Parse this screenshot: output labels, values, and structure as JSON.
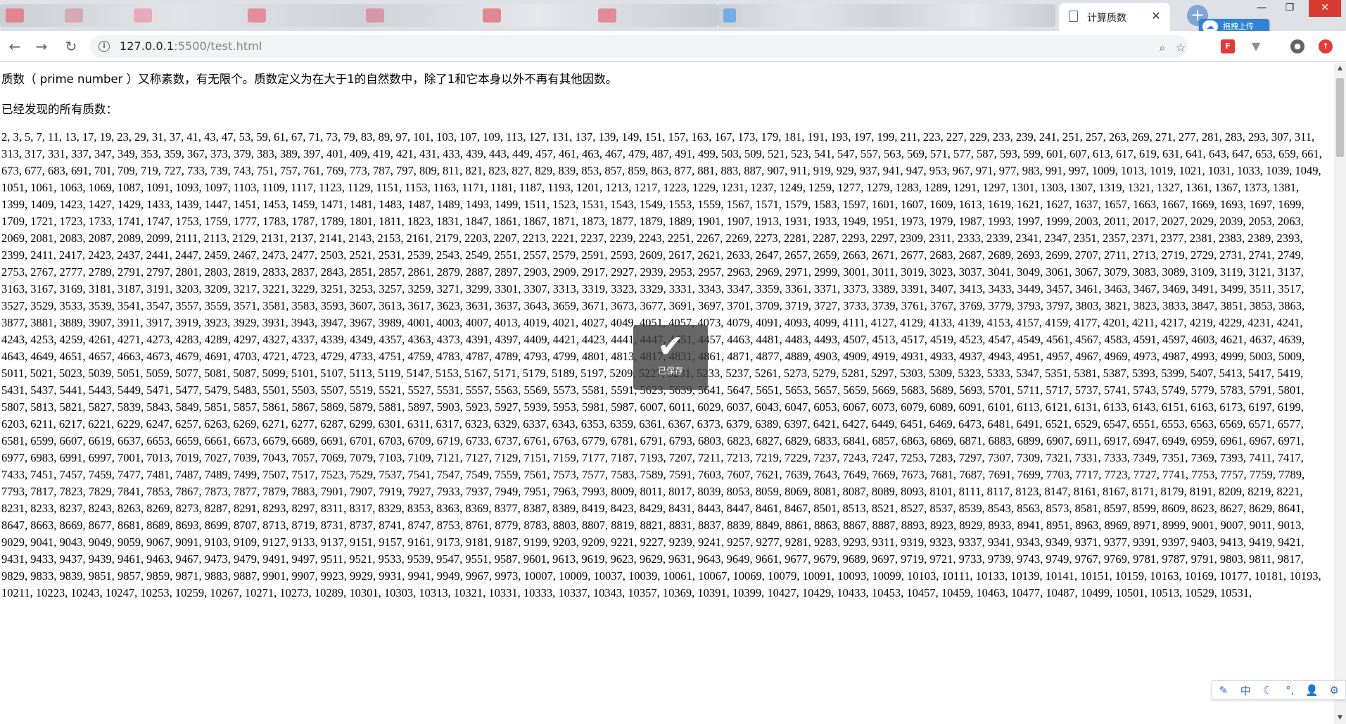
{
  "browser": {
    "active_tab_title": "计算质数",
    "close_tab_glyph": "✕",
    "new_tab_glyph": "+",
    "upload_badge_label": "拖拽上传",
    "url_host": "127.0.0.1",
    "url_rest": ":5500/test.html",
    "window_controls": [
      "—",
      "❐",
      "✕"
    ]
  },
  "page": {
    "intro": "质数（ prime number ）又称素数，有无限个。质数定义为在大于1的自然数中，除了1和它本身以外不再有其他因数。",
    "found_label": "已经发现的所有质数：",
    "primes_text": "2, 3, 5, 7, 11, 13, 17, 19, 23, 29, 31, 37, 41, 43, 47, 53, 59, 61, 67, 71, 73, 79, 83, 89, 97, 101, 103, 107, 109, 113, 127, 131, 137, 139, 149, 151, 157, 163, 167, 173, 179, 181, 191, 193, 197, 199, 211, 223, 227, 229, 233, 239, 241, 251, 257, 263, 269, 271, 277, 281, 283, 293, 307, 311, 313, 317, 331, 337, 347, 349, 353, 359, 367, 373, 379, 383, 389, 397, 401, 409, 419, 421, 431, 433, 439, 443, 449, 457, 461, 463, 467, 479, 487, 491, 499, 503, 509, 521, 523, 541, 547, 557, 563, 569, 571, 577, 587, 593, 599, 601, 607, 613, 617, 619, 631, 641, 643, 647, 653, 659, 661, 673, 677, 683, 691, 701, 709, 719, 727, 733, 739, 743, 751, 757, 761, 769, 773, 787, 797, 809, 811, 821, 823, 827, 829, 839, 853, 857, 859, 863, 877, 881, 883, 887, 907, 911, 919, 929, 937, 941, 947, 953, 967, 971, 977, 983, 991, 997, 1009, 1013, 1019, 1021, 1031, 1033, 1039, 1049, 1051, 1061, 1063, 1069, 1087, 1091, 1093, 1097, 1103, 1109, 1117, 1123, 1129, 1151, 1153, 1163, 1171, 1181, 1187, 1193, 1201, 1213, 1217, 1223, 1229, 1231, 1237, 1249, 1259, 1277, 1279, 1283, 1289, 1291, 1297, 1301, 1303, 1307, 1319, 1321, 1327, 1361, 1367, 1373, 1381, 1399, 1409, 1423, 1427, 1429, 1433, 1439, 1447, 1451, 1453, 1459, 1471, 1481, 1483, 1487, 1489, 1493, 1499, 1511, 1523, 1531, 1543, 1549, 1553, 1559, 1567, 1571, 1579, 1583, 1597, 1601, 1607, 1609, 1613, 1619, 1621, 1627, 1637, 1657, 1663, 1667, 1669, 1693, 1697, 1699, 1709, 1721, 1723, 1733, 1741, 1747, 1753, 1759, 1777, 1783, 1787, 1789, 1801, 1811, 1823, 1831, 1847, 1861, 1867, 1871, 1873, 1877, 1879, 1889, 1901, 1907, 1913, 1931, 1933, 1949, 1951, 1973, 1979, 1987, 1993, 1997, 1999, 2003, 2011, 2017, 2027, 2029, 2039, 2053, 2063, 2069, 2081, 2083, 2087, 2089, 2099, 2111, 2113, 2129, 2131, 2137, 2141, 2143, 2153, 2161, 2179, 2203, 2207, 2213, 2221, 2237, 2239, 2243, 2251, 2267, 2269, 2273, 2281, 2287, 2293, 2297, 2309, 2311, 2333, 2339, 2341, 2347, 2351, 2357, 2371, 2377, 2381, 2383, 2389, 2393, 2399, 2411, 2417, 2423, 2437, 2441, 2447, 2459, 2467, 2473, 2477, 2503, 2521, 2531, 2539, 2543, 2549, 2551, 2557, 2579, 2591, 2593, 2609, 2617, 2621, 2633, 2647, 2657, 2659, 2663, 2671, 2677, 2683, 2687, 2689, 2693, 2699, 2707, 2711, 2713, 2719, 2729, 2731, 2741, 2749, 2753, 2767, 2777, 2789, 2791, 2797, 2801, 2803, 2819, 2833, 2837, 2843, 2851, 2857, 2861, 2879, 2887, 2897, 2903, 2909, 2917, 2927, 2939, 2953, 2957, 2963, 2969, 2971, 2999, 3001, 3011, 3019, 3023, 3037, 3041, 3049, 3061, 3067, 3079, 3083, 3089, 3109, 3119, 3121, 3137, 3163, 3167, 3169, 3181, 3187, 3191, 3203, 3209, 3217, 3221, 3229, 3251, 3253, 3257, 3259, 3271, 3299, 3301, 3307, 3313, 3319, 3323, 3329, 3331, 3343, 3347, 3359, 3361, 3371, 3373, 3389, 3391, 3407, 3413, 3433, 3449, 3457, 3461, 3463, 3467, 3469, 3491, 3499, 3511, 3517, 3527, 3529, 3533, 3539, 3541, 3547, 3557, 3559, 3571, 3581, 3583, 3593, 3607, 3613, 3617, 3623, 3631, 3637, 3643, 3659, 3671, 3673, 3677, 3691, 3697, 3701, 3709, 3719, 3727, 3733, 3739, 3761, 3767, 3769, 3779, 3793, 3797, 3803, 3821, 3823, 3833, 3847, 3851, 3853, 3863, 3877, 3881, 3889, 3907, 3911, 3917, 3919, 3923, 3929, 3931, 3943, 3947, 3967, 3989, 4001, 4003, 4007, 4013, 4019, 4021, 4027, 4049, 4051, 4057, 4073, 4079, 4091, 4093, 4099, 4111, 4127, 4129, 4133, 4139, 4153, 4157, 4159, 4177, 4201, 4211, 4217, 4219, 4229, 4231, 4241, 4243, 4253, 4259, 4261, 4271, 4273, 4283, 4289, 4297, 4327, 4337, 4339, 4349, 4357, 4363, 4373, 4391, 4397, 4409, 4421, 4423, 4441, 4447, 4451, 4457, 4463, 4481, 4483, 4493, 4507, 4513, 4517, 4519, 4523, 4547, 4549, 4561, 4567, 4583, 4591, 4597, 4603, 4621, 4637, 4639, 4643, 4649, 4651, 4657, 4663, 4673, 4679, 4691, 4703, 4721, 4723, 4729, 4733, 4751, 4759, 4783, 4787, 4789, 4793, 4799, 4801, 4813, 4817, 4831, 4861, 4871, 4877, 4889, 4903, 4909, 4919, 4931, 4933, 4937, 4943, 4951, 4957, 4967, 4969, 4973, 4987, 4993, 4999, 5003, 5009, 5011, 5021, 5023, 5039, 5051, 5059, 5077, 5081, 5087, 5099, 5101, 5107, 5113, 5119, 5147, 5153, 5167, 5171, 5179, 5189, 5197, 5209, 5227, 5231, 5233, 5237, 5261, 5273, 5279, 5281, 5297, 5303, 5309, 5323, 5333, 5347, 5351, 5381, 5387, 5393, 5399, 5407, 5413, 5417, 5419, 5431, 5437, 5441, 5443, 5449, 5471, 5477, 5479, 5483, 5501, 5503, 5507, 5519, 5521, 5527, 5531, 5557, 5563, 5569, 5573, 5581, 5591, 5623, 5639, 5641, 5647, 5651, 5653, 5657, 5659, 5669, 5683, 5689, 5693, 5701, 5711, 5717, 5737, 5741, 5743, 5749, 5779, 5783, 5791, 5801, 5807, 5813, 5821, 5827, 5839, 5843, 5849, 5851, 5857, 5861, 5867, 5869, 5879, 5881, 5897, 5903, 5923, 5927, 5939, 5953, 5981, 5987, 6007, 6011, 6029, 6037, 6043, 6047, 6053, 6067, 6073, 6079, 6089, 6091, 6101, 6113, 6121, 6131, 6133, 6143, 6151, 6163, 6173, 6197, 6199, 6203, 6211, 6217, 6221, 6229, 6247, 6257, 6263, 6269, 6271, 6277, 6287, 6299, 6301, 6311, 6317, 6323, 6329, 6337, 6343, 6353, 6359, 6361, 6367, 6373, 6379, 6389, 6397, 6421, 6427, 6449, 6451, 6469, 6473, 6481, 6491, 6521, 6529, 6547, 6551, 6553, 6563, 6569, 6571, 6577, 6581, 6599, 6607, 6619, 6637, 6653, 6659, 6661, 6673, 6679, 6689, 6691, 6701, 6703, 6709, 6719, 6733, 6737, 6761, 6763, 6779, 6781, 6791, 6793, 6803, 6823, 6827, 6829, 6833, 6841, 6857, 6863, 6869, 6871, 6883, 6899, 6907, 6911, 6917, 6947, 6949, 6959, 6961, 6967, 6971, 6977, 6983, 6991, 6997, 7001, 7013, 7019, 7027, 7039, 7043, 7057, 7069, 7079, 7103, 7109, 7121, 7127, 7129, 7151, 7159, 7177, 7187, 7193, 7207, 7211, 7213, 7219, 7229, 7237, 7243, 7247, 7253, 7283, 7297, 7307, 7309, 7321, 7331, 7333, 7349, 7351, 7369, 7393, 7411, 7417, 7433, 7451, 7457, 7459, 7477, 7481, 7487, 7489, 7499, 7507, 7517, 7523, 7529, 7537, 7541, 7547, 7549, 7559, 7561, 7573, 7577, 7583, 7589, 7591, 7603, 7607, 7621, 7639, 7643, 7649, 7669, 7673, 7681, 7687, 7691, 7699, 7703, 7717, 7723, 7727, 7741, 7753, 7757, 7759, 7789, 7793, 7817, 7823, 7829, 7841, 7853, 7867, 7873, 7877, 7879, 7883, 7901, 7907, 7919, 7927, 7933, 7937, 7949, 7951, 7963, 7993, 8009, 8011, 8017, 8039, 8053, 8059, 8069, 8081, 8087, 8089, 8093, 8101, 8111, 8117, 8123, 8147, 8161, 8167, 8171, 8179, 8191, 8209, 8219, 8221, 8231, 8233, 8237, 8243, 8263, 8269, 8273, 8287, 8291, 8293, 8297, 8311, 8317, 8329, 8353, 8363, 8369, 8377, 8387, 8389, 8419, 8423, 8429, 8431, 8443, 8447, 8461, 8467, 8501, 8513, 8521, 8527, 8537, 8539, 8543, 8563, 8573, 8581, 8597, 8599, 8609, 8623, 8627, 8629, 8641, 8647, 8663, 8669, 8677, 8681, 8689, 8693, 8699, 8707, 8713, 8719, 8731, 8737, 8741, 8747, 8753, 8761, 8779, 8783, 8803, 8807, 8819, 8821, 8831, 8837, 8839, 8849, 8861, 8863, 8867, 8887, 8893, 8923, 8929, 8933, 8941, 8951, 8963, 8969, 8971, 8999, 9001, 9007, 9011, 9013, 9029, 9041, 9043, 9049, 9059, 9067, 9091, 9103, 9109, 9127, 9133, 9137, 9151, 9157, 9161, 9173, 9181, 9187, 9199, 9203, 9209, 9221, 9227, 9239, 9241, 9257, 9277, 9281, 9283, 9293, 9311, 9319, 9323, 9337, 9341, 9343, 9349, 9371, 9377, 9391, 9397, 9403, 9413, 9419, 9421, 9431, 9433, 9437, 9439, 9461, 9463, 9467, 9473, 9479, 9491, 9497, 9511, 9521, 9533, 9539, 9547, 9551, 9587, 9601, 9613, 9619, 9623, 9629, 9631, 9643, 9649, 9661, 9677, 9679, 9689, 9697, 9719, 9721, 9733, 9739, 9743, 9749, 9767, 9769, 9781, 9787, 9791, 9803, 9811, 9817, 9829, 9833, 9839, 9851, 9857, 9859, 9871, 9883, 9887, 9901, 9907, 9923, 9929, 9931, 9941, 9949, 9967, 9973, 10007, 10009, 10037, 10039, 10061, 10067, 10069, 10079, 10091, 10093, 10099, 10103, 10111, 10133, 10139, 10141, 10151, 10159, 10163, 10169, 10177, 10181, 10193, 10211, 10223, 10243, 10247, 10253, 10259, 10267, 10271, 10273, 10289, 10301, 10303, 10313, 10321, 10331, 10333, 10337, 10343, 10357, 10369, 10391, 10399, 10427, 10429, 10433, 10453, 10457, 10459, 10463, 10477, 10487, 10499, 10501, 10513, 10529, 10531,"
  },
  "toast": {
    "check_glyph": "✔",
    "label": "已保存"
  },
  "ime": [
    "✎",
    "中",
    "☾",
    "°,",
    "👤",
    "⚙"
  ],
  "colors": {
    "accent": "#2f84d8",
    "close_red": "#d63a31"
  }
}
